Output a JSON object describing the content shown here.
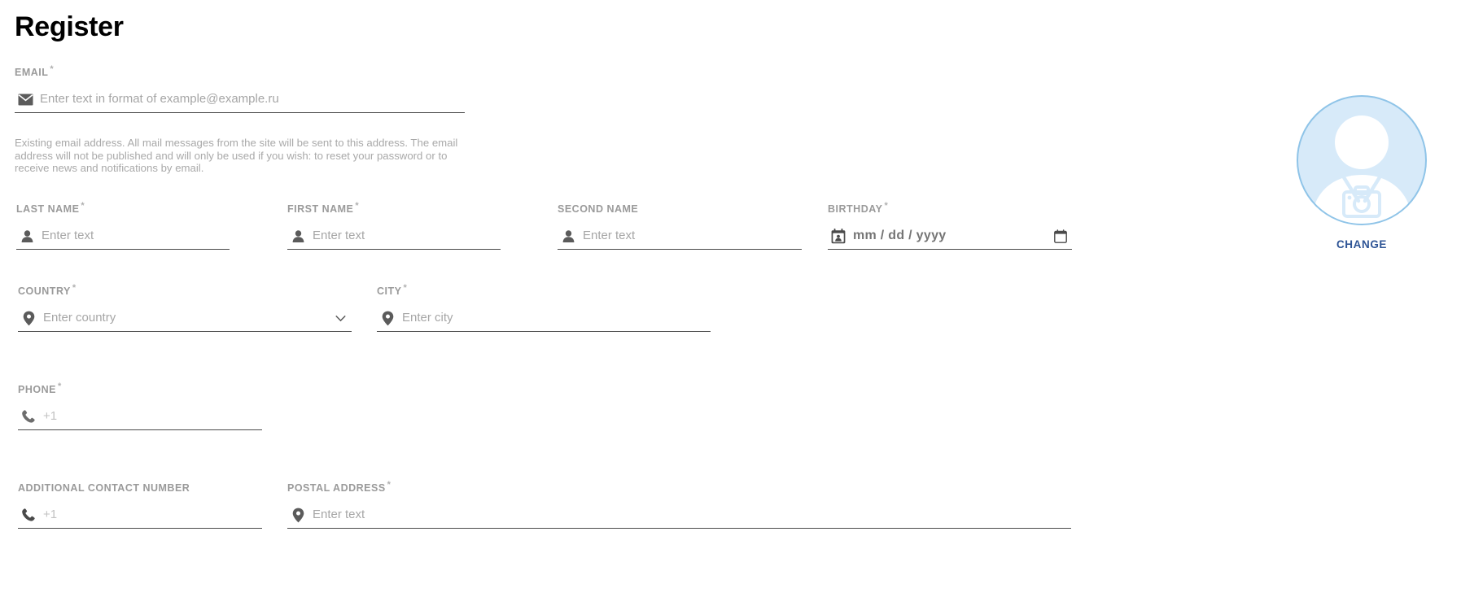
{
  "page": {
    "title": "Register"
  },
  "email": {
    "label": "EMAIL",
    "required": "*",
    "placeholder": "Enter text in format of example@example.ru",
    "value": "",
    "icon": "envelope-icon",
    "help": "Existing email address. All mail messages from the site will be sent to this address. The email address will not be published and will only be used if you wish: to reset your password or to receive news and notifications by email."
  },
  "fields": {
    "last_name": {
      "label": "LAST NAME",
      "required": "*",
      "placeholder": "Enter text",
      "value": "",
      "icon": "person-icon"
    },
    "first_name": {
      "label": "FIRST NAME",
      "required": "*",
      "placeholder": "Enter text",
      "value": "",
      "icon": "person-icon"
    },
    "second_name": {
      "label": "SECOND NAME",
      "required": "",
      "placeholder": "Enter text",
      "value": "",
      "icon": "person-icon"
    },
    "birthday": {
      "label": "BIRTHDAY",
      "required": "*",
      "placeholder": "mm / dd / yyyy",
      "value": "",
      "icon": "calendar-badge-icon",
      "trailing_icon": "calendar-picker-icon"
    },
    "country": {
      "label": "COUNTRY",
      "required": "*",
      "placeholder": "Enter country",
      "value": "",
      "icon": "location-pin-icon",
      "trailing_icon": "chevron-down-icon"
    },
    "city": {
      "label": "CITY",
      "required": "*",
      "placeholder": "Enter city",
      "value": "",
      "icon": "location-pin-icon"
    },
    "phone": {
      "label": "PHONE",
      "required": "*",
      "placeholder": "+1",
      "value": "",
      "icon": "phone-icon"
    },
    "additional_contact_number": {
      "label": "ADDITIONAL CONTACT NUMBER",
      "required": "",
      "placeholder": "+1",
      "value": "",
      "icon": "phone-icon"
    },
    "postal_address": {
      "label": "POSTAL ADDRESS",
      "required": "*",
      "placeholder": "Enter text",
      "value": "",
      "icon": "location-pin-icon"
    }
  },
  "avatar": {
    "icon": "avatar-photo-placeholder-icon",
    "change_label": "CHANGE",
    "fill_color": "#d7eaf9",
    "border_color": "#8fc4e8",
    "change_color": "#2f5596"
  }
}
